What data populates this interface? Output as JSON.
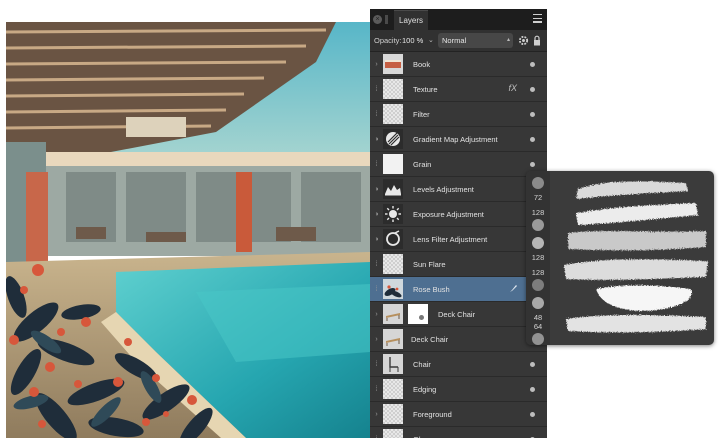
{
  "panel": {
    "tab_label": "Layers",
    "opacity_label": "Opacity:",
    "opacity_value": "100 %",
    "blend_mode": "Normal"
  },
  "layers": [
    {
      "name": "Book",
      "left": "expand",
      "thumb": "book",
      "selected": false
    },
    {
      "name": "Texture",
      "left": "checker",
      "thumb": "checker",
      "fx": "fX",
      "selected": false
    },
    {
      "name": "Filter",
      "left": "checker",
      "thumb": "checker",
      "selected": false
    },
    {
      "name": "Gradient Map Adjustment",
      "left": "circle",
      "thumb": "gradient-map",
      "selected": false
    },
    {
      "name": "Grain",
      "left": "checker",
      "thumb": "white",
      "selected": false
    },
    {
      "name": "Levels Adjustment",
      "left": "circle",
      "thumb": "levels",
      "selected": false
    },
    {
      "name": "Exposure Adjustment",
      "left": "circle",
      "thumb": "exposure",
      "selected": false
    },
    {
      "name": "Lens Filter Adjustment",
      "left": "circle",
      "thumb": "lens",
      "selected": false
    },
    {
      "name": "Sun Flare",
      "left": "checker",
      "thumb": "checker",
      "selected": false
    },
    {
      "name": "Rose Bush",
      "left": "checker",
      "thumb": "rosebush",
      "selected": true,
      "brush": true
    },
    {
      "name": "Deck Chair",
      "left": "expand",
      "thumb": "deckchair",
      "mask": true,
      "selected": false
    },
    {
      "name": "Deck Chair",
      "left": "expand",
      "thumb": "deckchair",
      "selected": false,
      "indent": true
    },
    {
      "name": "Chair",
      "left": "checker",
      "thumb": "chair",
      "selected": false
    },
    {
      "name": "Edging",
      "left": "checker",
      "thumb": "checker",
      "selected": false
    },
    {
      "name": "Foreground",
      "left": "expand",
      "thumb": "checker",
      "selected": false
    },
    {
      "name": "Glows",
      "left": "checker",
      "thumb": "checker",
      "selected": false
    }
  ],
  "brushes": [
    {
      "size": "72"
    },
    {
      "size": "128"
    },
    {
      "size": "128"
    },
    {
      "size": "128"
    },
    {
      "size": "48"
    },
    {
      "size": "64"
    }
  ],
  "colors": {
    "panel_bg": "#313131",
    "header_bg": "#1d1d1d",
    "selected_row": "#4e6f91",
    "popup_bg": "#3b3b3b",
    "sky": "#7fc6cf",
    "pool": "#2fb0b5"
  }
}
